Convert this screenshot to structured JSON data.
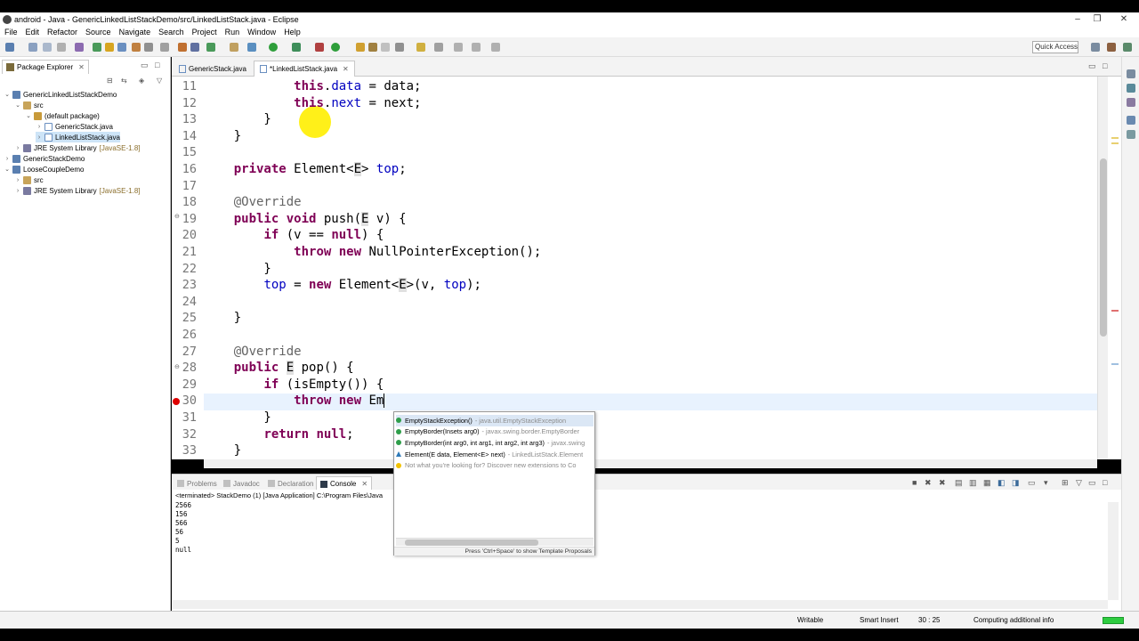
{
  "window": {
    "title": "android - Java - GenericLinkedListStackDemo/src/LinkedListStack.java - Eclipse",
    "controls": [
      "–",
      "❐",
      "✕"
    ]
  },
  "menu": [
    "File",
    "Edit",
    "Refactor",
    "Source",
    "Navigate",
    "Search",
    "Project",
    "Run",
    "Window",
    "Help"
  ],
  "toolbar": {
    "quick_access": "Quick Access"
  },
  "package_explorer": {
    "title": "Package Explorer",
    "tree": [
      {
        "label": "GenericLinkedListStackDemo",
        "extra": ""
      },
      {
        "label": "src",
        "extra": ""
      },
      {
        "label": "(default package)",
        "extra": ""
      },
      {
        "label": "GenericStack.java",
        "extra": ""
      },
      {
        "label": "LinkedListStack.java",
        "extra": ""
      },
      {
        "label": "JRE System Library",
        "extra": "[JavaSE-1.8]"
      },
      {
        "label": "GenericStackDemo",
        "extra": ""
      },
      {
        "label": "LooseCoupleDemo",
        "extra": ""
      },
      {
        "label": "src",
        "extra": ""
      },
      {
        "label": "JRE System Library",
        "extra": "[JavaSE-1.8]"
      }
    ]
  },
  "editor": {
    "tabs": [
      {
        "label": "GenericStack.java"
      },
      {
        "label": "*LinkedListStack.java"
      }
    ],
    "line_numbers": [
      "11",
      "12",
      "13",
      "14",
      "15",
      "16",
      "17",
      "18",
      "19",
      "20",
      "21",
      "22",
      "23",
      "24",
      "25",
      "26",
      "27",
      "28",
      "29",
      "30",
      "31",
      "32",
      "33"
    ]
  },
  "bottom": {
    "tabs": [
      "Problems",
      "Javadoc",
      "Declaration",
      "Console"
    ],
    "console_header": "<terminated> StackDemo (1) [Java Application] C:\\Program Files\\Java",
    "output": [
      "2566",
      "156",
      "566",
      "56",
      "5",
      "null"
    ]
  },
  "proposals": {
    "items": [
      {
        "name": "EmptyStackException()",
        "detail": " - java.util.EmptyStackException"
      },
      {
        "name": "EmptyBorder(Insets arg0)",
        "detail": " - javax.swing.border.EmptyBorder"
      },
      {
        "name": "EmptyBorder(int arg0, int arg1, int arg2, int arg3)",
        "detail": " - javax.swing"
      },
      {
        "name": "Element(E data, Element<E> next)",
        "detail": " - LinkedListStack.Element"
      },
      {
        "name": "Not what you're looking for? Discover new extensions to Co",
        "detail": ""
      }
    ],
    "footer": "Press 'Ctrl+Space' to show Template Proposals"
  },
  "status": {
    "writable": "Writable",
    "insert_mode": "Smart Insert",
    "position": "30 : 25",
    "task": "Computing additional info"
  }
}
